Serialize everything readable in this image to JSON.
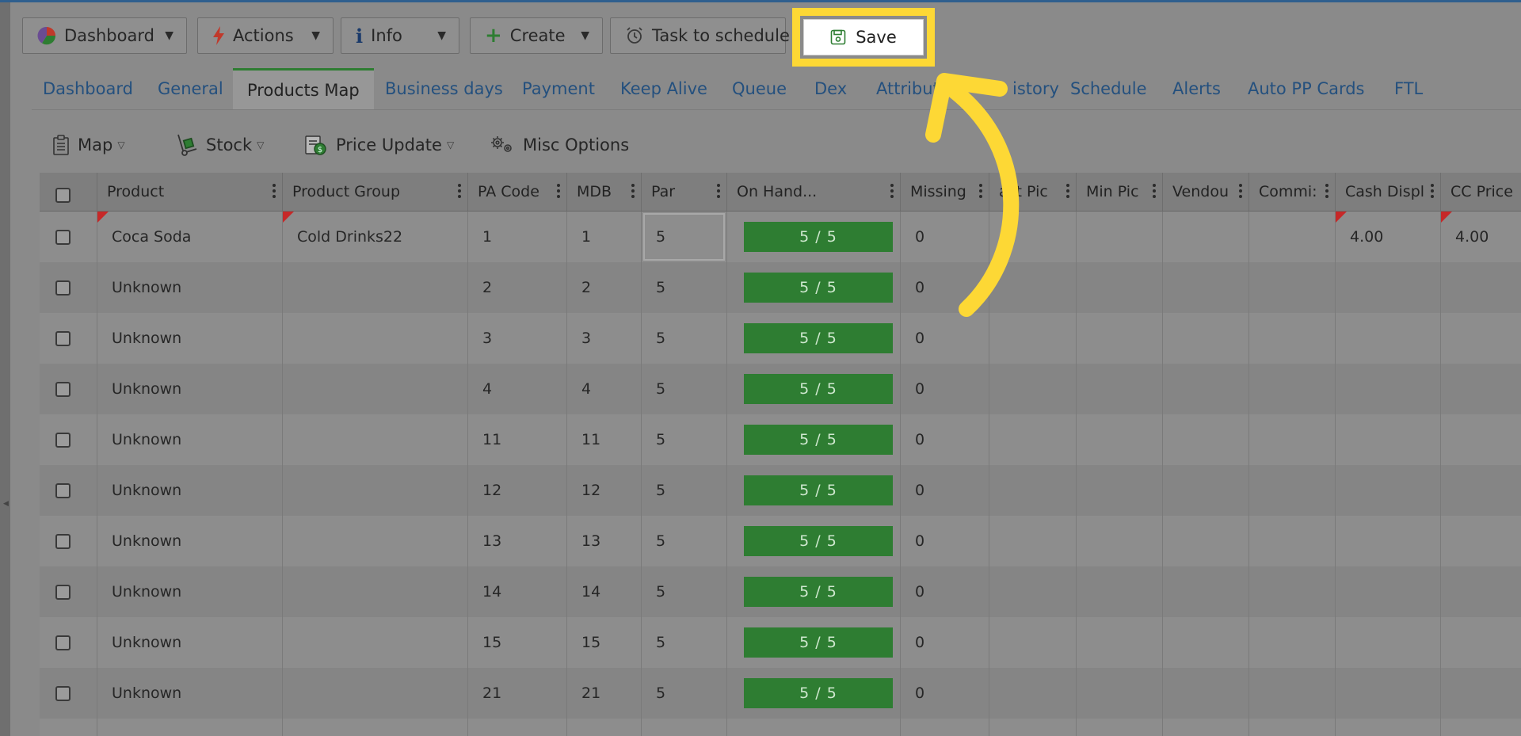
{
  "toolbar": {
    "dashboard_label": "Dashboard",
    "actions_label": "Actions",
    "info_label": "Info",
    "create_label": "Create",
    "task_label": "Task to schedule",
    "save_label": "Save"
  },
  "tabs": [
    {
      "label": "Dashboard"
    },
    {
      "label": "General"
    },
    {
      "label": "Products Map"
    },
    {
      "label": "Business days"
    },
    {
      "label": "Payment"
    },
    {
      "label": "Keep Alive"
    },
    {
      "label": "Queue"
    },
    {
      "label": "Dex"
    },
    {
      "label": "Attribut"
    },
    {
      "label": "istory"
    },
    {
      "label": "Schedule"
    },
    {
      "label": "Alerts"
    },
    {
      "label": "Auto PP Cards"
    },
    {
      "label": "FTL"
    }
  ],
  "subtoolbar": {
    "map_label": "Map",
    "stock_label": "Stock",
    "price_update_label": "Price Update",
    "misc_label": "Misc Options"
  },
  "columns": [
    {
      "label": "Product"
    },
    {
      "label": "Product Group"
    },
    {
      "label": "PA Code"
    },
    {
      "label": "MDB"
    },
    {
      "label": "Par"
    },
    {
      "label": "On Hand..."
    },
    {
      "label": "Missing"
    },
    {
      "label": "ast Pic"
    },
    {
      "label": "Min Pic"
    },
    {
      "label": "Vendou"
    },
    {
      "label": "Commi:"
    },
    {
      "label": "Cash Displ"
    },
    {
      "label": "CC Price"
    }
  ],
  "rows": [
    {
      "product": "Coca Soda",
      "group": "Cold Drinks22",
      "pa_code": "1",
      "mdb": "1",
      "par": "5",
      "on_hand": "5 / 5",
      "missing": "0",
      "cash_display": "4.00",
      "cc_price": "4.00"
    },
    {
      "product": "Unknown",
      "group": "",
      "pa_code": "2",
      "mdb": "2",
      "par": "5",
      "on_hand": "5 / 5",
      "missing": "0",
      "cash_display": "",
      "cc_price": ""
    },
    {
      "product": "Unknown",
      "group": "",
      "pa_code": "3",
      "mdb": "3",
      "par": "5",
      "on_hand": "5 / 5",
      "missing": "0",
      "cash_display": "",
      "cc_price": ""
    },
    {
      "product": "Unknown",
      "group": "",
      "pa_code": "4",
      "mdb": "4",
      "par": "5",
      "on_hand": "5 / 5",
      "missing": "0",
      "cash_display": "",
      "cc_price": ""
    },
    {
      "product": "Unknown",
      "group": "",
      "pa_code": "11",
      "mdb": "11",
      "par": "5",
      "on_hand": "5 / 5",
      "missing": "0",
      "cash_display": "",
      "cc_price": ""
    },
    {
      "product": "Unknown",
      "group": "",
      "pa_code": "12",
      "mdb": "12",
      "par": "5",
      "on_hand": "5 / 5",
      "missing": "0",
      "cash_display": "",
      "cc_price": ""
    },
    {
      "product": "Unknown",
      "group": "",
      "pa_code": "13",
      "mdb": "13",
      "par": "5",
      "on_hand": "5 / 5",
      "missing": "0",
      "cash_display": "",
      "cc_price": ""
    },
    {
      "product": "Unknown",
      "group": "",
      "pa_code": "14",
      "mdb": "14",
      "par": "5",
      "on_hand": "5 / 5",
      "missing": "0",
      "cash_display": "",
      "cc_price": ""
    },
    {
      "product": "Unknown",
      "group": "",
      "pa_code": "15",
      "mdb": "15",
      "par": "5",
      "on_hand": "5 / 5",
      "missing": "0",
      "cash_display": "",
      "cc_price": ""
    },
    {
      "product": "Unknown",
      "group": "",
      "pa_code": "21",
      "mdb": "21",
      "par": "5",
      "on_hand": "5 / 5",
      "missing": "0",
      "cash_display": "",
      "cc_price": ""
    },
    {
      "product": "",
      "group": "",
      "pa_code": "",
      "mdb": "",
      "par": "",
      "on_hand": "",
      "missing": "",
      "cash_display": "",
      "cc_price": ""
    }
  ],
  "colors": {
    "highlight": "#fdd835",
    "on_hand_fill": "#2e7d32",
    "flag": "#c62828",
    "link": "#24507e"
  },
  "icons": {
    "dashboard": "pie-chart-icon",
    "actions": "lightning-icon",
    "info": "info-icon",
    "create": "plus-icon",
    "task": "alarm-clock-icon",
    "save": "floppy-disk-icon",
    "map": "clipboard-icon",
    "stock": "hand-truck-icon",
    "price_update": "price-tag-icon",
    "misc": "gears-icon",
    "pointer": "curved-arrow-icon"
  }
}
